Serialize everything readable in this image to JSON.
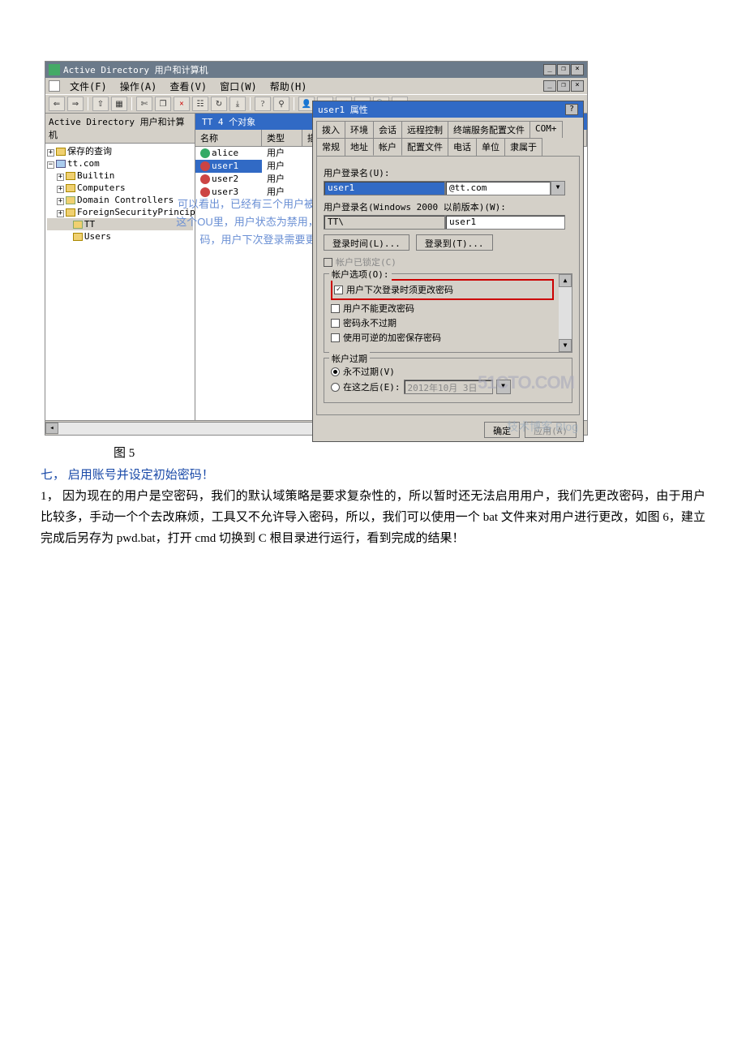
{
  "app": {
    "window_title": "Active Directory 用户和计算机",
    "mdi_min": "_",
    "mdi_restore": "❐",
    "mdi_close": "×"
  },
  "menu": {
    "file": "文件(F)",
    "action": "操作(A)",
    "view": "查看(V)",
    "window": "窗口(W)",
    "help": "帮助(H)"
  },
  "tree": {
    "header": "Active Directory 用户和计算机",
    "saved": "保存的查询",
    "domain": "tt.com",
    "builtin": "Builtin",
    "computers": "Computers",
    "dc": "Domain Controllers",
    "fsp": "ForeignSecurityPrincipa",
    "tt": "TT",
    "users": "Users"
  },
  "list": {
    "statusbar": "TT    4 个对象",
    "col_name": "名称",
    "col_type": "类型",
    "col_desc": "描述",
    "rows": [
      {
        "name": "alice",
        "type": "用户"
      },
      {
        "name": "user1",
        "type": "用户"
      },
      {
        "name": "user2",
        "type": "用户"
      },
      {
        "name": "user3",
        "type": "用户"
      }
    ]
  },
  "annotation": {
    "l1": "可以看出，已经有三个用户被导入到了TT",
    "l2": "这个OU里，用户状态为禁用，并且是空密",
    "l3": "码，用户下次登录需要更改密码"
  },
  "dialog": {
    "title": "user1 属性",
    "tabs1": [
      "拨入",
      "环境",
      "会话",
      "远程控制",
      "终端服务配置文件",
      "COM+"
    ],
    "tabs2": [
      "常规",
      "地址",
      "帐户",
      "配置文件",
      "电话",
      "单位",
      "隶属于"
    ],
    "logon_label": "用户登录名(U):",
    "logon_value": "user1",
    "domain_suffix": "@tt.com",
    "pre2000_label": "用户登录名(Windows 2000 以前版本)(W):",
    "pre2000_domain": "TT\\",
    "pre2000_value": "user1",
    "btn_logon_hours": "登录时间(L)...",
    "btn_logon_to": "登录到(T)...",
    "lock_label": "帐户已锁定(C)",
    "options_legend": "帐户选项(O):",
    "opt_change_pwd": "用户下次登录时须更改密码",
    "opt_cannot_change": "用户不能更改密码",
    "opt_never_expire": "密码永不过期",
    "opt_reversible": "使用可逆的加密保存密码",
    "expire_legend": "帐户过期",
    "expire_never": "永不过期(V)",
    "expire_at": "在这之后(E):",
    "expire_date": "2012年10月 3日",
    "btn_ok": "确定",
    "btn_apply": "应用(A)"
  },
  "watermark": {
    "main": "51CTO.COM",
    "sub": "技术博客 Blog"
  },
  "doc": {
    "caption": "图 5",
    "section": "七，  启用账号并设定初始密码！",
    "p1": "1，  因为现在的用户是空密码，我们的默认域策略是要求复杂性的，所以暂时还无法启用用户，我们先更改密码，由于用户比较多，手动一个个去改麻烦，工具又不允许导入密码，所以，我们可以使用一个 bat 文件来对用户进行更改，如图 6，建立完成后另存为 pwd.bat，打开 cmd 切换到 C 根目录进行运行，看到完成的结果！"
  }
}
